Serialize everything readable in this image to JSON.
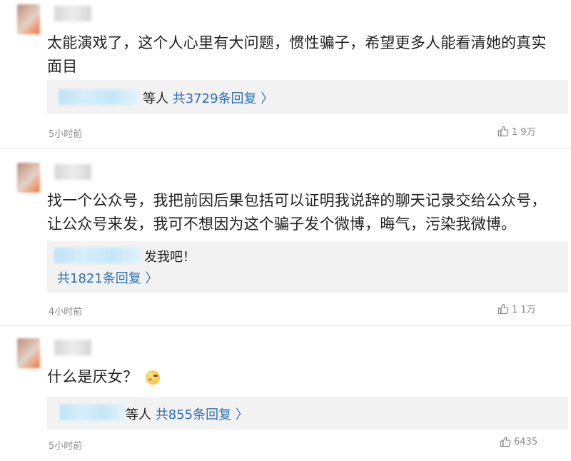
{
  "comments": [
    {
      "text": "太能演戏了，这个人心里有大问题，惯性骗子，希望更多人能看清她的真实面目",
      "reply_suffix": "等人",
      "reply_count": "共3729条回复",
      "time": "5小时前",
      "likes": "1 9万"
    },
    {
      "text": "找一个公众号，我把前因后果包括可以证明我说辞的聊天记录交给公众号，让公众号来发，我可不想因为这个骗子发个微博，晦气，污染我微博。",
      "reply_suffix": "发我吧！",
      "reply_count": "共1821条回复",
      "time": "4小时前",
      "likes": "1 1万"
    },
    {
      "text": "什么是厌女？",
      "reply_suffix": "等人",
      "reply_count": "共855条回复",
      "time": "5小时前",
      "likes": "6435"
    }
  ],
  "icons": {
    "like": "thumbs-up-icon",
    "chevron": "chevron-right-icon",
    "emoji": "blushing-face-icon"
  },
  "colors": {
    "link": "#2f6fb3",
    "reply_bg": "#f2f2f2",
    "meta": "#8a8a8a"
  }
}
